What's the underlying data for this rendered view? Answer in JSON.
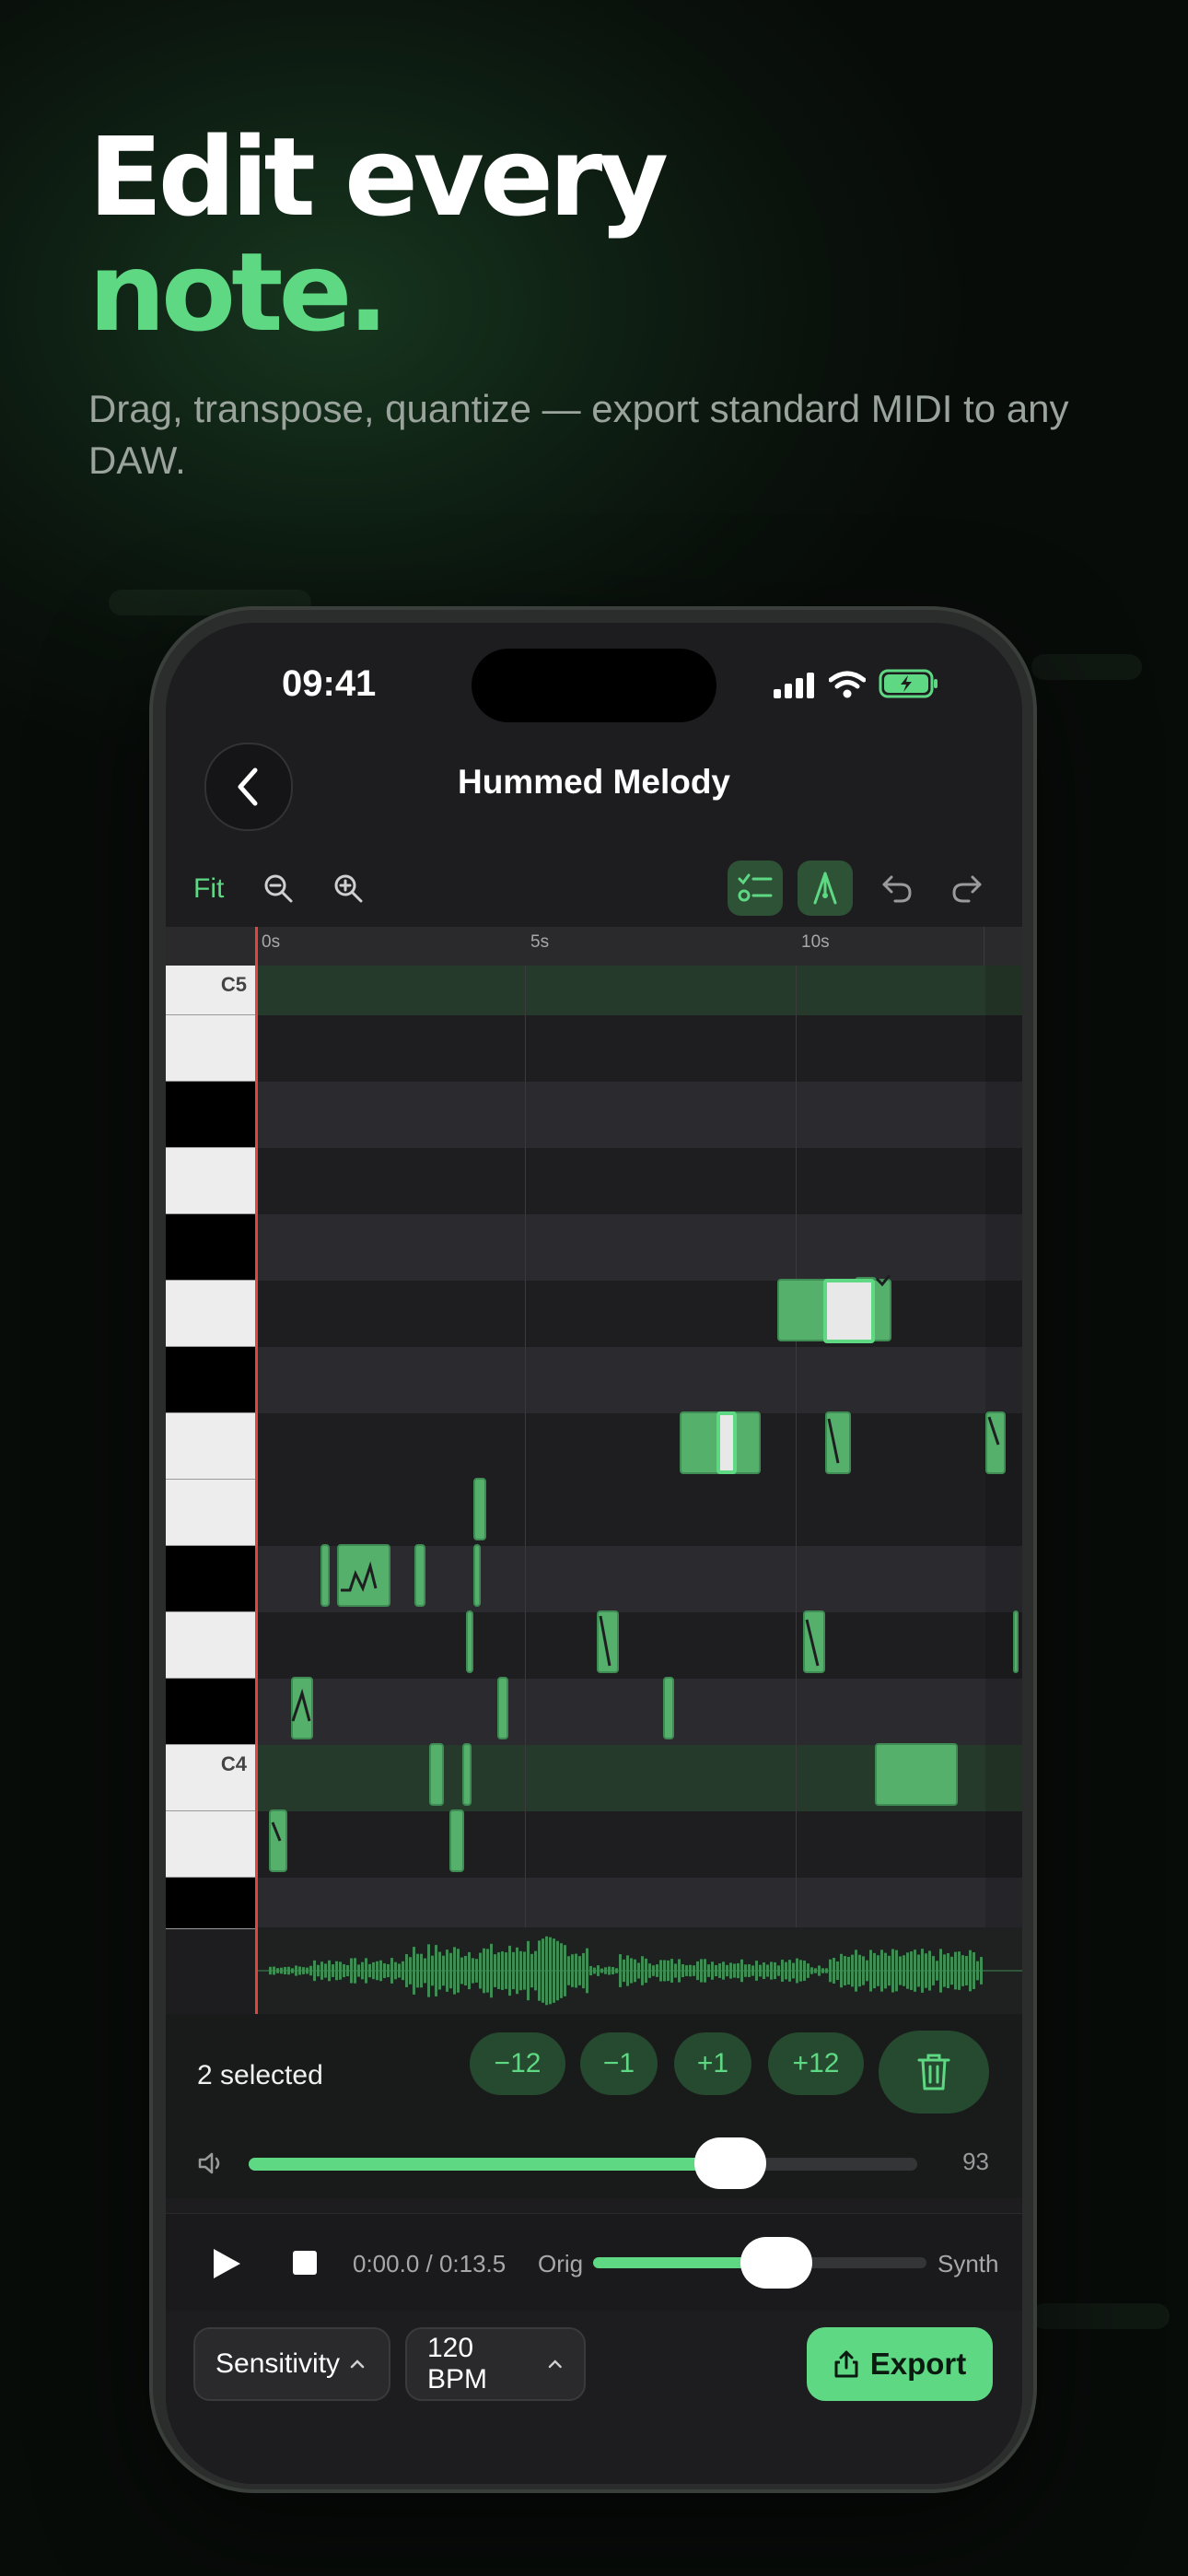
{
  "marketing": {
    "headline_line1": "Edit every",
    "headline_line2": "note.",
    "subtitle": "Drag, transpose, quantize — export standard MIDI to any DAW."
  },
  "status_bar": {
    "time": "09:41"
  },
  "nav": {
    "title": "Hummed Melody",
    "back_icon": "chevron-left-icon"
  },
  "toolbar": {
    "fit_label": "Fit",
    "icons": [
      "zoom-out-icon",
      "zoom-in-icon",
      "select-mode-icon",
      "pitch-edit-icon",
      "undo-icon",
      "redo-icon"
    ]
  },
  "timeline": {
    "ticks": [
      "0s",
      "5s",
      "10s"
    ]
  },
  "piano": {
    "labels": {
      "c5": "C5",
      "c4": "C4"
    }
  },
  "selection": {
    "count_text": "2 selected",
    "transpose_buttons": [
      "−12",
      "−1",
      "+1",
      "+12"
    ],
    "delete_icon": "trash-icon"
  },
  "volume": {
    "value": "93",
    "level_fraction": 0.72,
    "icon": "speaker-icon"
  },
  "transport": {
    "time": "0:00.0 / 0:13.5",
    "mix_left": "Orig",
    "mix_right": "Synth",
    "mix_fraction": 0.55
  },
  "bottom_bar": {
    "sensitivity_label": "Sensitivity",
    "bpm_label": "120 BPM",
    "export_label": "Export"
  },
  "colors": {
    "accent": "#5fd884",
    "playhead": "#e0463b",
    "background": "#1d1d1f"
  }
}
